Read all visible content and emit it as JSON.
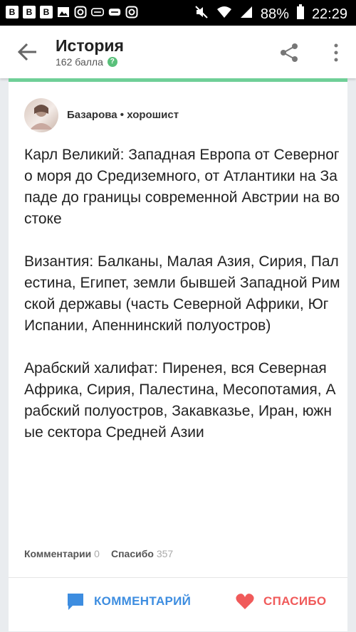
{
  "status_bar": {
    "battery": "88%",
    "time": "22:29"
  },
  "header": {
    "title": "История",
    "points": "162 балла",
    "help_icon": "?"
  },
  "answer": {
    "author": "Базарова",
    "separator": "•",
    "rank": "хорошист",
    "paragraphs": [
      "Карл Великий: Западная Европа от Северного моря до Средиземного, от Атлантики на Западе до границы современной Австрии на востоке",
      "Византия: Балканы, Малая Азия, Сирия, Палестина, Египет, земли бывшей Западной Римской державы (часть Северной Африки, Юг Испании, Апеннинский полуостров)",
      "Арабский халифат: Пиренея, вся Северная Африка, Сирия, Палестина, Месопотамия, Арабский полуостров, Закавказье, Иран, южные сектора Средней Азии"
    ],
    "stats": {
      "comments_label": "Комментарии",
      "comments_count": "0",
      "thanks_label": "Спасибо",
      "thanks_count": "357"
    }
  },
  "actions": {
    "comment_label": "КОММЕНТАРИЙ",
    "thanks_label": "СПАСИБО"
  },
  "colors": {
    "accent_green": "#6fcf97",
    "comment_blue": "#3d8de0",
    "thanks_red": "#f05a5a"
  }
}
